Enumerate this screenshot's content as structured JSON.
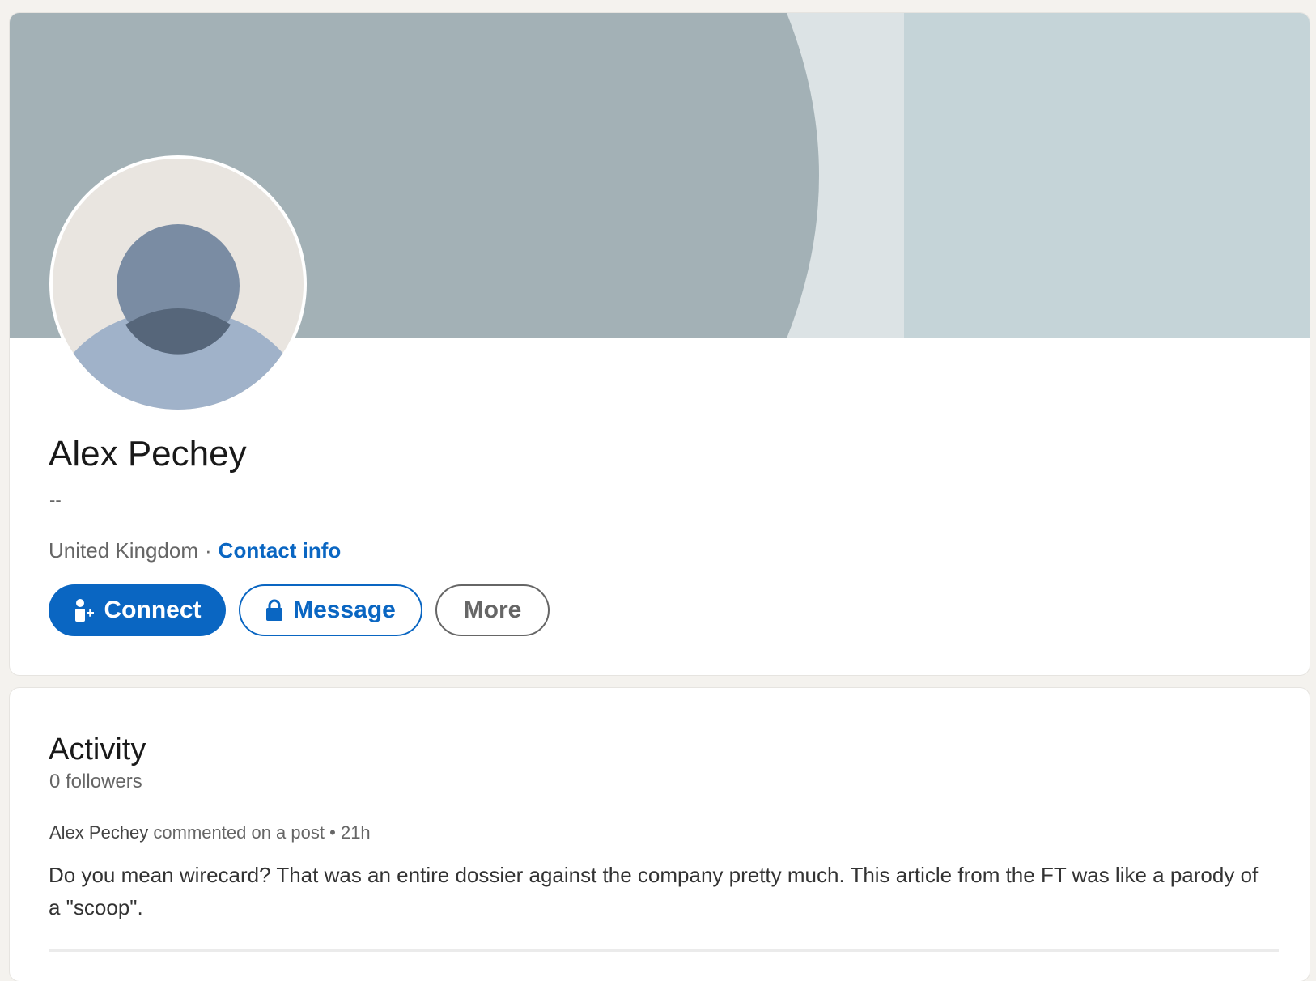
{
  "colors": {
    "accent": "#0a66c2",
    "banner_dark": "#a3b1b6",
    "banner_mid": "#dce3e5",
    "banner_light": "#c5d4d8",
    "avatar_bg": "#e9e5e0",
    "avatar_head": "#7a8ca3",
    "avatar_body": "#a0b2c9"
  },
  "profile": {
    "name": "Alex Pechey",
    "headline": "--",
    "location": "United Kingdom",
    "separator": "·",
    "contact_info_label": "Contact info",
    "avatar_icon": "person-silhouette-icon",
    "actions": {
      "connect_label": "Connect",
      "connect_icon": "add-person-icon",
      "message_label": "Message",
      "message_icon": "lock-icon",
      "more_label": "More"
    }
  },
  "activity": {
    "title": "Activity",
    "followers": "0 followers",
    "items": [
      {
        "author": "Alex Pechey",
        "action": "commented on a post",
        "bullet": "•",
        "time": "21h",
        "text": "Do you mean wirecard? That was an entire dossier against the company pretty much. This article from the FT was like a parody of a \"scoop\"."
      }
    ]
  }
}
